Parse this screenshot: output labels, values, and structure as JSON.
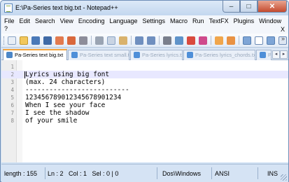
{
  "window": {
    "title": "E:\\Pa-Series text big.txt - Notepad++"
  },
  "window_buttons": {
    "minimize": "–",
    "maximize": "□",
    "close": "✕"
  },
  "menu": {
    "items": [
      "File",
      "Edit",
      "Search",
      "View",
      "Encoding",
      "Language",
      "Settings",
      "Macro",
      "Run",
      "TextFX",
      "Plugins",
      "Window"
    ],
    "overflow": "?",
    "close_doc": "X"
  },
  "toolbar": {
    "icons": [
      "new-file-icon",
      "open-file-icon",
      "save-icon",
      "save-all-icon",
      "close-icon",
      "close-all-icon",
      "print-icon",
      "cut-icon",
      "copy-icon",
      "paste-icon",
      "undo-icon",
      "redo-icon",
      "find-icon",
      "replace-icon",
      "zoom-in-icon",
      "zoom-out-icon",
      "sync-v-icon",
      "sync-h-icon",
      "word-wrap-icon",
      "show-all-chars-icon",
      "indent-guide-icon",
      "doc-map-icon"
    ],
    "more": "»"
  },
  "tabs": [
    {
      "label": "Pa-Series text big.txt",
      "active": true
    },
    {
      "label": "Pa-Series text small.txt",
      "active": false
    },
    {
      "label": "Pa-Series lyrics.txt",
      "active": false
    },
    {
      "label": "Pa-Series lyrics_chords.txt",
      "active": false
    },
    {
      "label": "Pa",
      "active": false
    }
  ],
  "tab_nav": {
    "left": "◂",
    "right": "▸"
  },
  "editor": {
    "lines": [
      {
        "n": "1",
        "text": ""
      },
      {
        "n": "2",
        "text": "Lyrics using big font"
      },
      {
        "n": "3",
        "text": "(max. 24 characters)"
      },
      {
        "n": "4",
        "text": "--------------------------"
      },
      {
        "n": "5",
        "text": "123456789012345678901234"
      },
      {
        "n": "6",
        "text": "When I see your face"
      },
      {
        "n": "7",
        "text": "I see the shadow"
      },
      {
        "n": "8",
        "text": "of your smile"
      }
    ]
  },
  "status": {
    "length": "length : 155",
    "position": "Ln : 2   Col : 1   Sel : 0 | 0",
    "eol": "Dos\\Windows",
    "encoding": "ANSI",
    "mode": "INS"
  },
  "colors": {
    "current_line": "#e8e8ff",
    "tab_accent": "#f4a43c",
    "close_button": "#c44a2e"
  }
}
